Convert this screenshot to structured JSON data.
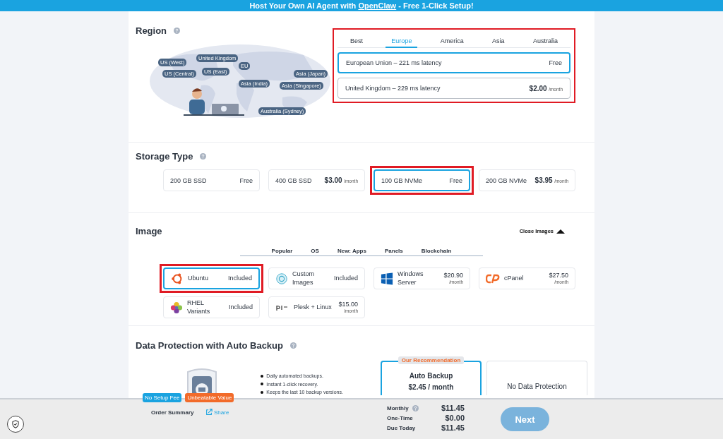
{
  "banner": {
    "text": "Host Your Own AI Agent with ",
    "link": "OpenClaw",
    "text_after": " - Free 1-Click Setup!"
  },
  "region": {
    "title": "Region",
    "highlighted": true,
    "map_labels": [
      "US (West)",
      "United Kingdom",
      "US (Central)",
      "US (East)",
      "EU",
      "Asia (Japan)",
      "Asia (India)",
      "Asia (Singapore)",
      "Australia (Sydney)"
    ],
    "tabs": [
      {
        "label": "Best",
        "selected": false
      },
      {
        "label": "Europe",
        "selected": true
      },
      {
        "label": "America",
        "selected": false
      },
      {
        "label": "Asia",
        "selected": false
      },
      {
        "label": "Australia",
        "selected": false
      }
    ],
    "options": [
      {
        "name": "European Union – 221 ms latency",
        "price": "Free",
        "selected": true
      },
      {
        "name": "United Kingdom – 229 ms latency",
        "price": "$2.00",
        "period": "/month",
        "selected": false
      }
    ]
  },
  "storage": {
    "title": "Storage Type",
    "options": [
      {
        "name": "200 GB SSD",
        "price": "Free",
        "selected": false,
        "highlighted": false
      },
      {
        "name": "400 GB SSD",
        "price": "$3.00",
        "period": "/month",
        "selected": false,
        "highlighted": false
      },
      {
        "name": "100 GB NVMe",
        "price": "Free",
        "selected": true,
        "highlighted": true
      },
      {
        "name": "200 GB NVMe",
        "price": "$3.95",
        "period": "/month",
        "selected": false,
        "highlighted": false
      }
    ]
  },
  "image": {
    "title": "Image",
    "toggle": {
      "label": "Close Images",
      "expanded": true
    },
    "tabs": [
      "Popular",
      "OS",
      "New: Apps",
      "Panels",
      "Blockchain"
    ],
    "items": [
      {
        "kind": "ubuntu",
        "name": "Ubuntu",
        "price": "Included",
        "selected": true,
        "highlighted": true
      },
      {
        "kind": "custom",
        "name": "Custom Images",
        "price": "Included",
        "selected": false,
        "highlighted": false
      },
      {
        "kind": "windows",
        "name": "Windows Server",
        "price": "$20.90",
        "period": "/month",
        "selected": false,
        "highlighted": false
      },
      {
        "kind": "cpanel",
        "name": "cPanel",
        "price": "$27.50",
        "period": "/month",
        "selected": false,
        "highlighted": false
      },
      {
        "kind": "rhel",
        "name": "RHEL Variants",
        "price": "Included",
        "selected": false,
        "highlighted": false
      },
      {
        "kind": "plesk",
        "name": "Plesk + Linux",
        "price": "$15.00",
        "period": "/month",
        "selected": false,
        "highlighted": false
      }
    ]
  },
  "backup": {
    "title": "Data Protection with Auto Backup",
    "features": [
      "Daily automated backups.",
      "Instant 1-click recovery.",
      "Keeps the last 10 backup versions."
    ],
    "badges": [
      {
        "label": "No Setup Fee",
        "color": "#1aa3e0"
      },
      {
        "label": "Unbeatable Value",
        "color": "#f26b2a"
      }
    ],
    "options": [
      {
        "tag": "Our Recommendation",
        "name": "Auto Backup",
        "price": "$2.45 / month",
        "selected": true
      },
      {
        "name": "No Data Protection",
        "selected": false
      }
    ]
  },
  "summary": {
    "title": "Order Summary",
    "share": "Share",
    "lines": [
      {
        "label": "Monthly",
        "value": "$11.45",
        "info": true
      },
      {
        "label": "One-Time",
        "value": "$0.00",
        "info": false
      },
      {
        "label": "Due Today",
        "value": "$11.45",
        "info": false
      }
    ],
    "next": {
      "label": "Next",
      "disabled": true
    }
  }
}
